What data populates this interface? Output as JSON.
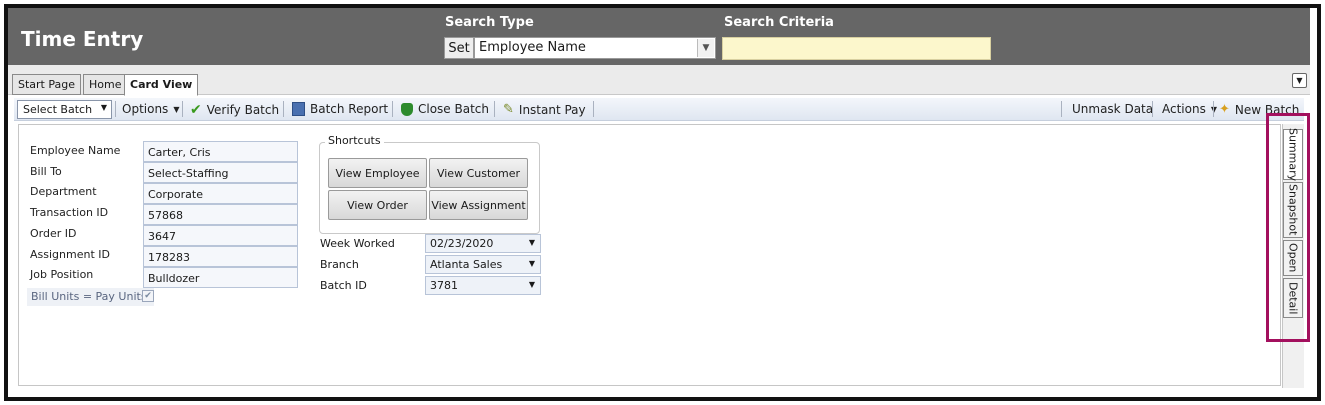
{
  "header": {
    "title": "Time Entry",
    "search_type_label": "Search Type",
    "search_criteria_label": "Search Criteria",
    "set_label": "Set",
    "search_type_value": "Employee Name",
    "search_criteria_value": ""
  },
  "tabs": [
    {
      "label": "Start Page"
    },
    {
      "label": "Home"
    },
    {
      "label": "Card View",
      "active": true
    }
  ],
  "toolbar": {
    "select_batch": "Select Batch",
    "options": "Options",
    "verify_batch": "Verify Batch",
    "batch_report": "Batch Report",
    "close_batch": "Close Batch",
    "instant_pay": "Instant Pay",
    "unmask_data": "Unmask Data",
    "actions": "Actions",
    "new_batch": "New Batch"
  },
  "fields": [
    {
      "label": "Employee Name",
      "value": "Carter, Cris"
    },
    {
      "label": "Bill To",
      "value": "Select-Staffing"
    },
    {
      "label": "Department",
      "value": "Corporate"
    },
    {
      "label": "Transaction ID",
      "value": "57868"
    },
    {
      "label": "Order ID",
      "value": "3647"
    },
    {
      "label": "Assignment ID",
      "value": "178283"
    },
    {
      "label": "Job Position",
      "value": "Bulldozer"
    }
  ],
  "bill_units": {
    "label": "Bill Units = Pay Units",
    "checked": true
  },
  "shortcuts": {
    "legend": "Shortcuts",
    "view_employee": "View Employee",
    "view_customer": "View Customer",
    "view_order": "View Order",
    "view_assignment": "View Assignment"
  },
  "dropdowns": [
    {
      "label": "Week Worked",
      "value": "02/23/2020"
    },
    {
      "label": "Branch",
      "value": "Atlanta Sales"
    },
    {
      "label": "Batch ID",
      "value": "3781"
    }
  ],
  "side_tabs": [
    {
      "label": "Summary",
      "active": true
    },
    {
      "label": "Snapshot"
    },
    {
      "label": "Open"
    },
    {
      "label": "Detail"
    }
  ],
  "colors": {
    "header_bg": "#666666",
    "criteria_bg": "#fcf7cc",
    "highlight": "#a3105e"
  }
}
